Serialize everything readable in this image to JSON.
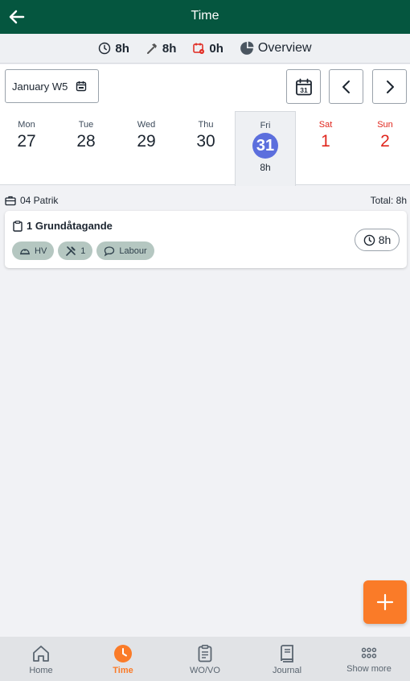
{
  "header": {
    "title": "Time"
  },
  "summary": {
    "total_hours": "8h",
    "work_hours": "8h",
    "absence_hours": "0h",
    "overview_label": "Overview"
  },
  "week_selector": {
    "label": "January W5"
  },
  "calendar_icon_day": "31",
  "days": [
    {
      "name": "Mon",
      "number": "27"
    },
    {
      "name": "Tue",
      "number": "28"
    },
    {
      "name": "Wed",
      "number": "29"
    },
    {
      "name": "Thu",
      "number": "30"
    },
    {
      "name": "Fri",
      "number": "31",
      "hours": "8h"
    },
    {
      "name": "Sat",
      "number": "1"
    },
    {
      "name": "Sun",
      "number": "2"
    }
  ],
  "group": {
    "name": "04 Patrik",
    "total": "Total: 8h"
  },
  "entry": {
    "title": "1 Grundåtagande",
    "chips": [
      "HV",
      "1",
      "Labour"
    ],
    "hours": "8h"
  },
  "nav": [
    {
      "label": "Home"
    },
    {
      "label": "Time"
    },
    {
      "label": "WO/VO"
    },
    {
      "label": "Journal"
    },
    {
      "label": "Show more"
    }
  ],
  "colors": {
    "header_bg": "#05563f",
    "accent": "#fa7b28",
    "selected_day": "#5c6fdd",
    "weekend": "#e0261d",
    "chip": "#b5c7c1"
  }
}
